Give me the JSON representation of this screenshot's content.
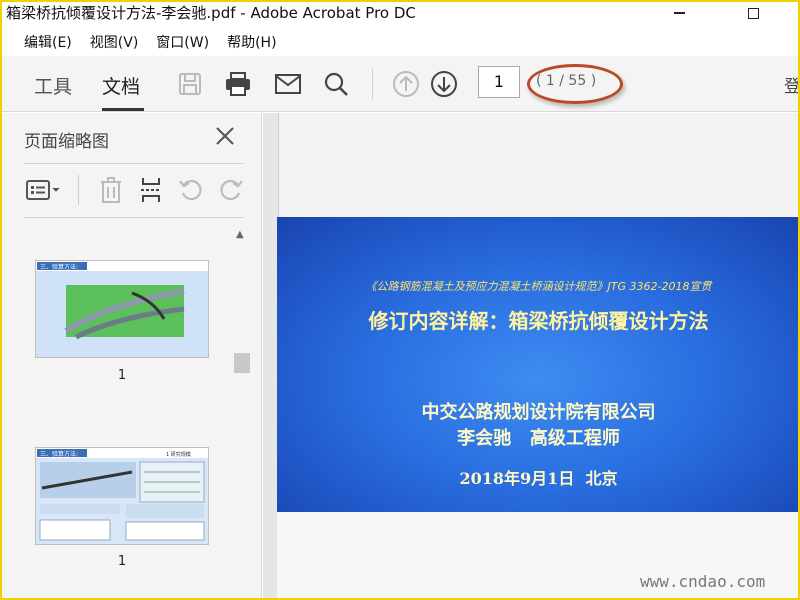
{
  "window": {
    "title": "箱梁桥抗倾覆设计方法-李会驰.pdf - Adobe Acrobat Pro DC"
  },
  "menu": [
    "编辑(E)",
    "视图(V)",
    "窗口(W)",
    "帮助(H)"
  ],
  "toolbar": {
    "tab_tools": "工具",
    "tab_document": "文档",
    "page_number": "1",
    "page_count": "( 1 / 55 )",
    "right_cut_text": "登"
  },
  "sidebar": {
    "title": "页面缩略图",
    "thumbnails": [
      {
        "label": "1",
        "heading": "三、验算方法:"
      },
      {
        "label": "1",
        "heading": "三、验算方法:",
        "tag": "1 研究规模"
      }
    ]
  },
  "slide": {
    "subtitle": "《公路钢筋混凝土及预应力混凝土桥涵设计规范》JTG 3362-2018宣贯",
    "title": "修订内容详解：箱梁桥抗倾覆设计方法",
    "org": "中交公路规划设计院有限公司",
    "person": "李会驰   高级工程师",
    "date": "2018年9月1日  北京"
  },
  "watermark": "www.cndao.com",
  "colors": {
    "slide_blue": "#2a6fe0",
    "slide_title_yellow": "#fff3a0",
    "annotation_red": "#b84a28",
    "frame_yellow": "#f0d000"
  }
}
